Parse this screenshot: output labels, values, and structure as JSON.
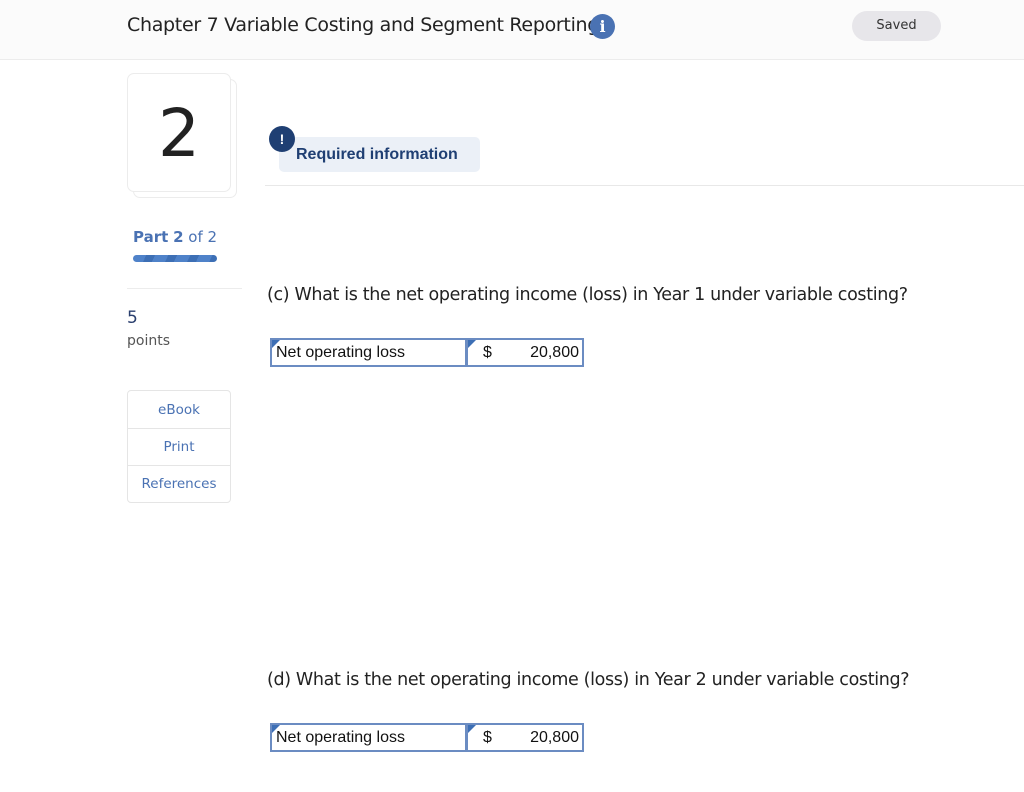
{
  "header": {
    "title": "Chapter 7 Variable Costing and Segment Reporting",
    "info_icon": "info-icon",
    "status": "Saved"
  },
  "sidebar": {
    "question_number": "2",
    "part_prefix": "Part",
    "part_current": "2",
    "part_suffix": "of 2",
    "progress_fraction": 1.0,
    "points_value": "5",
    "points_label": "points",
    "tools": [
      {
        "label": "eBook"
      },
      {
        "label": "Print"
      },
      {
        "label": "References"
      }
    ]
  },
  "main": {
    "required_icon": "!",
    "required_label": "Required information",
    "questions": [
      {
        "prompt": "(c) What is the net operating income (loss) in Year 1 under variable costing?",
        "answer_label": "Net operating loss",
        "currency": "$",
        "answer_value": "20,800"
      },
      {
        "prompt": "(d) What is the net operating income (loss) in Year 2 under variable costing?",
        "answer_label": "Net operating loss",
        "currency": "$",
        "answer_value": "20,800"
      }
    ]
  }
}
